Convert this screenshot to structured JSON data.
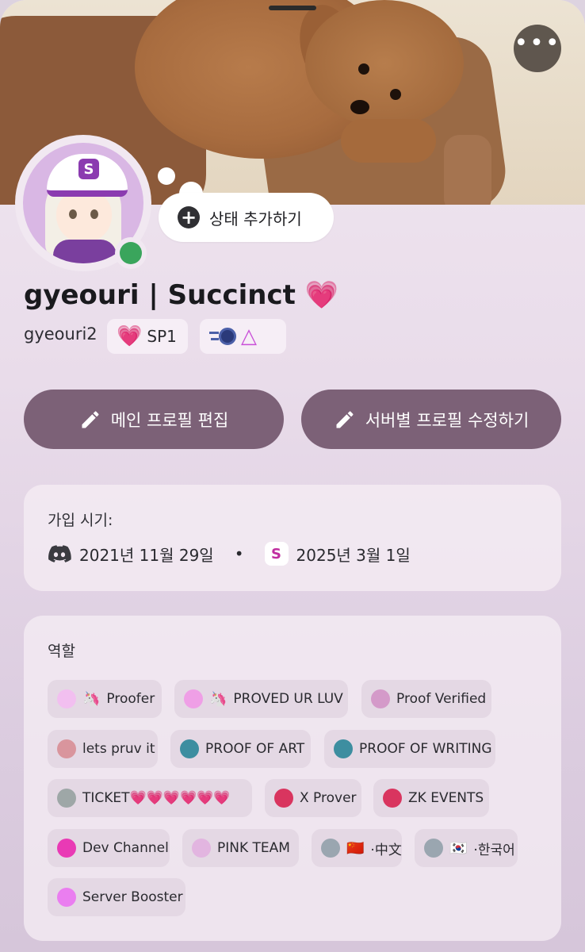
{
  "profile": {
    "display_name": "gyeouri | Succinct",
    "display_name_emoji": "💗",
    "username": "gyeouri2",
    "status_button_label": "상태 추가하기",
    "badge_sp_label": "SP1"
  },
  "actions": {
    "edit_main_label": "메인 프로필 편집",
    "edit_server_label": "서버별 프로필 수정하기"
  },
  "join": {
    "title": "가입 시기:",
    "discord_date": "2021년 11월 29일",
    "separator": "•",
    "server_date": "2025년 3월 1일"
  },
  "roles": {
    "title": "역할",
    "items": [
      {
        "label": "Proofer",
        "emoji": "🦄",
        "color": "#f2bff0"
      },
      {
        "label": "PROVED UR LUV",
        "emoji": "🦄",
        "color": "#ef9fe6"
      },
      {
        "label": "Proof Verified",
        "emoji": "",
        "color": "#d49ac9"
      },
      {
        "label": "lets pruv it",
        "emoji": "",
        "color": "#d9959d"
      },
      {
        "label": "PROOF OF ART",
        "emoji": "",
        "color": "#3d8ea0"
      },
      {
        "label": "PROOF OF WRITING",
        "emoji": "",
        "color": "#3d8ea0"
      },
      {
        "label": "TICKET💗💗💗💗💗💗",
        "emoji": "",
        "color": "#9ea7a7"
      },
      {
        "label": "X Prover",
        "emoji": "",
        "color": "#d9355f"
      },
      {
        "label": "ZK EVENTS",
        "emoji": "",
        "color": "#d9355f"
      },
      {
        "label": "Dev Channel",
        "emoji": "",
        "color": "#e93ab5"
      },
      {
        "label": "PINK TEAM",
        "emoji": "",
        "color": "#e2b5e0"
      },
      {
        "label": "·中文",
        "emoji": "🇨🇳",
        "color": "#9aa6b0"
      },
      {
        "label": "·한국어",
        "emoji": "🇰🇷",
        "color": "#9aa6b0"
      },
      {
        "label": "Server Booster",
        "emoji": "",
        "color": "#ea7ef0"
      }
    ]
  },
  "colors": {
    "button_bg": "#7c6177",
    "online": "#3aa55c",
    "heart": "#e6379b"
  },
  "icons": {
    "more": "more-options-icon",
    "plus": "plus-icon",
    "pencil": "pencil-icon",
    "discord": "discord-icon",
    "succinct": "succinct-icon"
  }
}
